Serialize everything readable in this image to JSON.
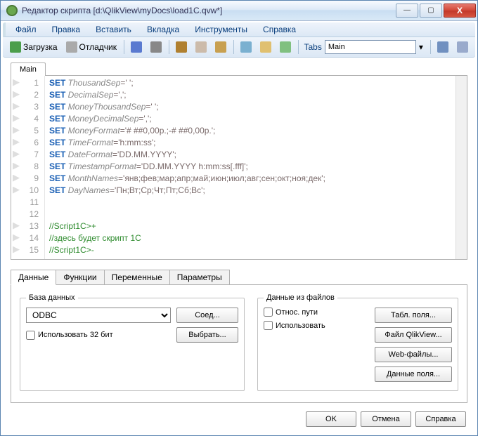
{
  "window": {
    "title": "Редактор скрипта [d:\\QlikView\\myDocs\\load1C.qvw*]"
  },
  "winbtns": {
    "min": "—",
    "max": "▢",
    "close": "X"
  },
  "menu": [
    "Файл",
    "Правка",
    "Вставить",
    "Вкладка",
    "Инструменты",
    "Справка"
  ],
  "toolbar": {
    "reload": "Загрузка",
    "debug": "Отладчик",
    "tabs_label": "Tabs",
    "tabs_value": "Main"
  },
  "script_tab": "Main",
  "code_lines": [
    {
      "n": 1,
      "seg": [
        {
          "t": "SET ",
          "c": "kw"
        },
        {
          "t": "ThousandSep",
          "c": "var"
        },
        {
          "t": "=' ';",
          "c": "str"
        }
      ]
    },
    {
      "n": 2,
      "seg": [
        {
          "t": "SET ",
          "c": "kw"
        },
        {
          "t": "DecimalSep",
          "c": "var"
        },
        {
          "t": "=',';",
          "c": "str"
        }
      ]
    },
    {
      "n": 3,
      "seg": [
        {
          "t": "SET ",
          "c": "kw"
        },
        {
          "t": "MoneyThousandSep",
          "c": "var"
        },
        {
          "t": "=' ';",
          "c": "str"
        }
      ]
    },
    {
      "n": 4,
      "seg": [
        {
          "t": "SET ",
          "c": "kw"
        },
        {
          "t": "MoneyDecimalSep",
          "c": "var"
        },
        {
          "t": "=',';",
          "c": "str"
        }
      ]
    },
    {
      "n": 5,
      "seg": [
        {
          "t": "SET ",
          "c": "kw"
        },
        {
          "t": "MoneyFormat",
          "c": "var"
        },
        {
          "t": "='# ##0,00р.;-# ##0,00р.';",
          "c": "str"
        }
      ]
    },
    {
      "n": 6,
      "seg": [
        {
          "t": "SET ",
          "c": "kw"
        },
        {
          "t": "TimeFormat",
          "c": "var"
        },
        {
          "t": "='h:mm:ss';",
          "c": "str"
        }
      ]
    },
    {
      "n": 7,
      "seg": [
        {
          "t": "SET ",
          "c": "kw"
        },
        {
          "t": "DateFormat",
          "c": "var"
        },
        {
          "t": "='DD.MM.YYYY';",
          "c": "str"
        }
      ]
    },
    {
      "n": 8,
      "seg": [
        {
          "t": "SET ",
          "c": "kw"
        },
        {
          "t": "TimestampFormat",
          "c": "var"
        },
        {
          "t": "='DD.MM.YYYY h:mm:ss[.fff]';",
          "c": "str"
        }
      ]
    },
    {
      "n": 9,
      "seg": [
        {
          "t": "SET ",
          "c": "kw"
        },
        {
          "t": "MonthNames",
          "c": "var"
        },
        {
          "t": "='янв;фев;мар;апр;май;июн;июл;авг;сен;окт;ноя;дек';",
          "c": "str"
        }
      ]
    },
    {
      "n": 10,
      "seg": [
        {
          "t": "SET ",
          "c": "kw"
        },
        {
          "t": "DayNames",
          "c": "var"
        },
        {
          "t": "='Пн;Вт;Ср;Чт;Пт;Сб;Вс';",
          "c": "str"
        }
      ]
    },
    {
      "n": 11,
      "seg": []
    },
    {
      "n": 12,
      "seg": []
    },
    {
      "n": 13,
      "seg": [
        {
          "t": "//Script1C>+",
          "c": "cmt"
        }
      ]
    },
    {
      "n": 14,
      "seg": [
        {
          "t": "//здесь будет скрипт 1С",
          "c": "cmt"
        }
      ]
    },
    {
      "n": 15,
      "seg": [
        {
          "t": "//Script1C>-",
          "c": "cmt"
        }
      ]
    }
  ],
  "bottom_tabs": [
    "Данные",
    "Функции",
    "Переменные",
    "Параметры"
  ],
  "db_group": {
    "legend": "База данных",
    "source": "ODBC",
    "connect_btn": "Соед...",
    "force32_label": "Использовать 32 бит",
    "select_btn": "Выбрать..."
  },
  "files_group": {
    "legend": "Данные из файлов",
    "relpath_label": "Относ. пути",
    "use_label": "Использовать",
    "buttons": [
      "Табл. поля...",
      "Файл QlikView...",
      "Web-файлы...",
      "Данные поля..."
    ]
  },
  "footer": {
    "ok": "OK",
    "cancel": "Отмена",
    "help": "Справка"
  }
}
